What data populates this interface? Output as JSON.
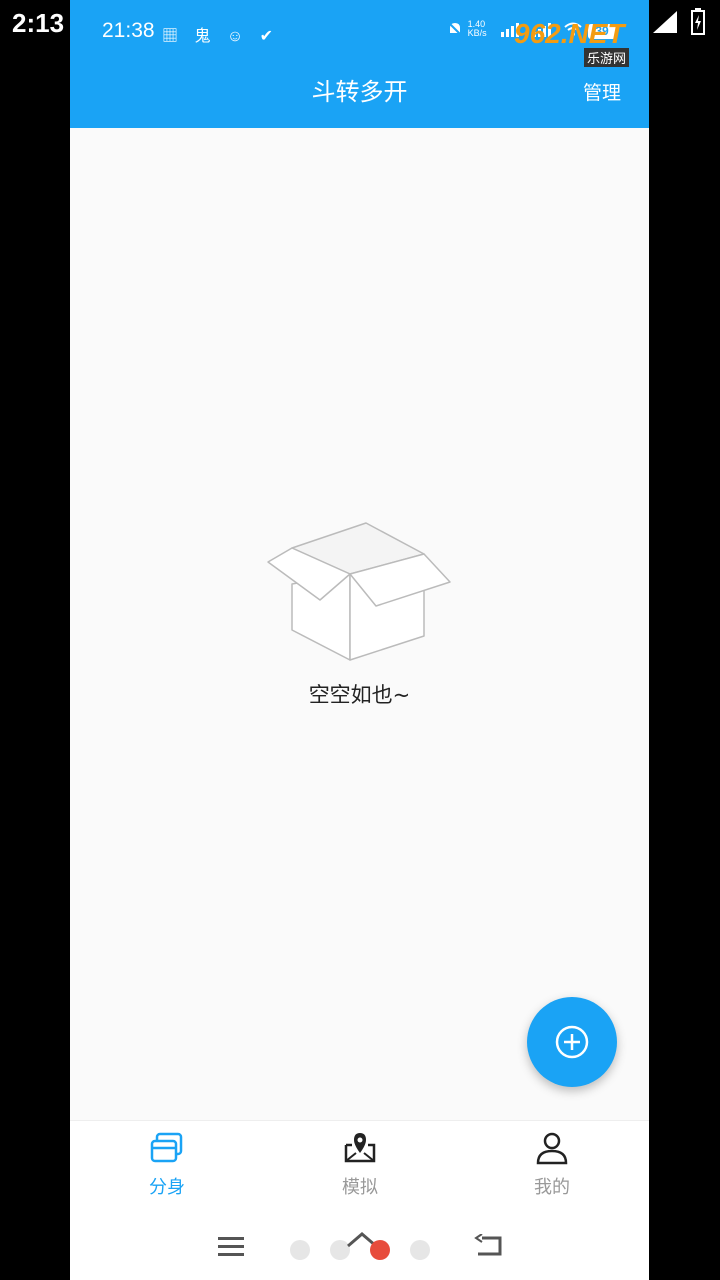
{
  "outer_status": {
    "time": "2:13"
  },
  "inner_status": {
    "time": "21:38",
    "left_icons": "▦ 鬼 ☺ ✔",
    "speed": "1.40 KB/s",
    "battery": "39"
  },
  "header": {
    "title": "斗转多开",
    "manage_label": "管理"
  },
  "empty_state": {
    "text": "空空如也~"
  },
  "fab": {
    "icon": "plus-circle-icon"
  },
  "tabs": [
    {
      "label": "分身",
      "icon": "clone-icon",
      "active": true
    },
    {
      "label": "模拟",
      "icon": "location-box-icon",
      "active": false
    },
    {
      "label": "我的",
      "icon": "person-icon",
      "active": false
    }
  ],
  "watermark": {
    "big": "962.NET",
    "small": "乐游网"
  },
  "colors": {
    "accent": "#1aa3f5",
    "background": "#fafafa"
  }
}
